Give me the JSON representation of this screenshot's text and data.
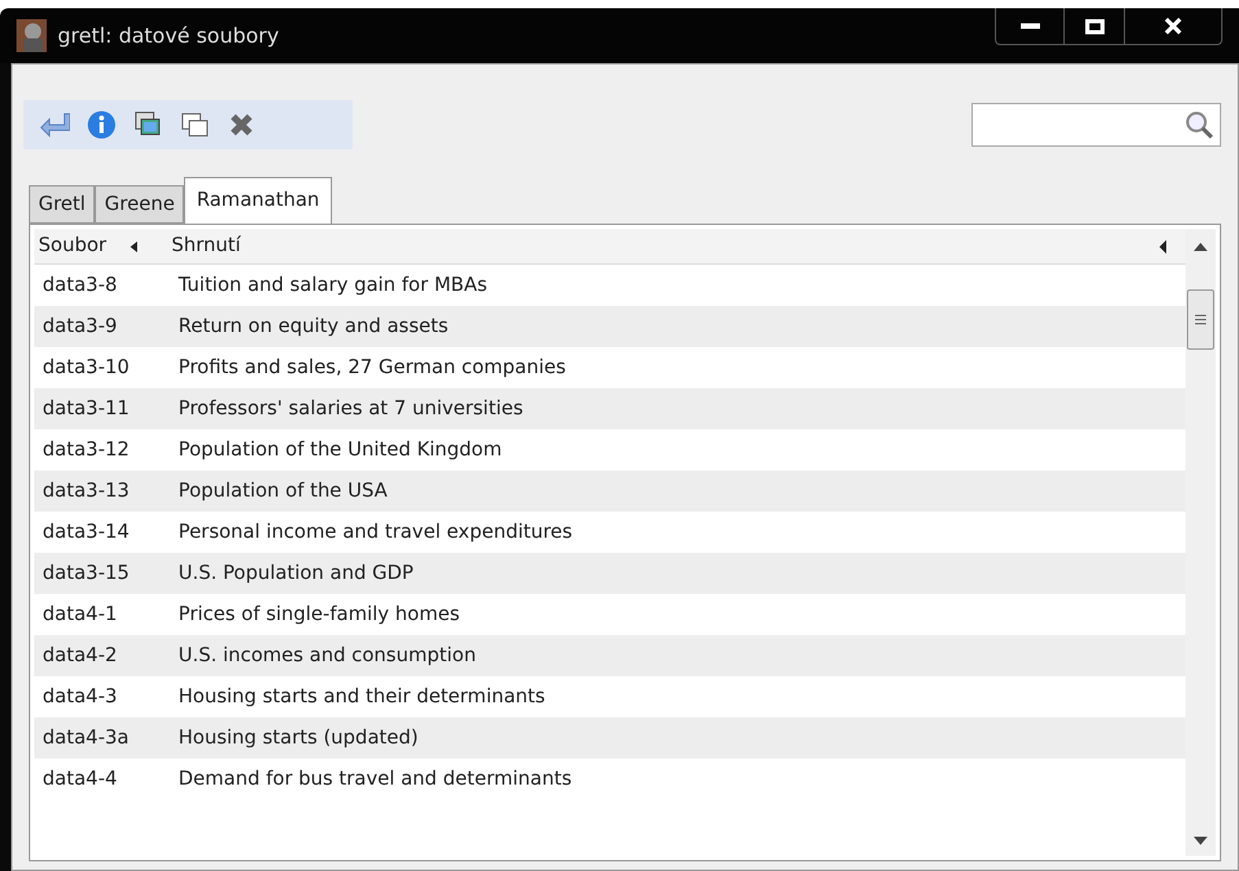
{
  "window": {
    "title": "gretl: datové soubory"
  },
  "tabs": [
    {
      "label": "Gretl",
      "selected": false
    },
    {
      "label": "Greene",
      "selected": false
    },
    {
      "label": "Ramanathan",
      "selected": true
    }
  ],
  "table": {
    "columns": [
      "Soubor",
      "Shrnutí"
    ],
    "rows": [
      [
        "data3-8",
        "Tuition and salary gain for MBAs"
      ],
      [
        "data3-9",
        "Return on equity and assets"
      ],
      [
        "data3-10",
        "Profits and sales, 27 German companies"
      ],
      [
        "data3-11",
        "Professors' salaries at 7 universities"
      ],
      [
        "data3-12",
        "Population of the United Kingdom"
      ],
      [
        "data3-13",
        "Population of the USA"
      ],
      [
        "data3-14",
        "Personal income and travel expenditures"
      ],
      [
        "data3-15",
        "U.S. Population and GDP"
      ],
      [
        "data4-1",
        "Prices of single-family homes"
      ],
      [
        "data4-2",
        "U.S. incomes and consumption"
      ],
      [
        "data4-3",
        "Housing starts and their determinants"
      ],
      [
        "data4-3a",
        "Housing starts (updated)"
      ],
      [
        "data4-4",
        "Demand for bus travel and determinants"
      ]
    ]
  }
}
